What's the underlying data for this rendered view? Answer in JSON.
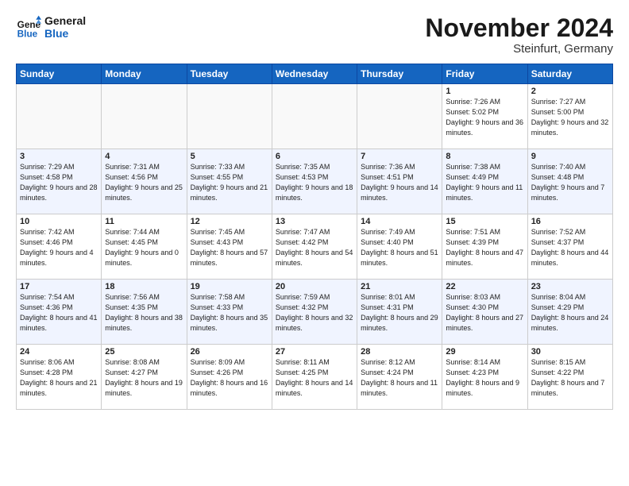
{
  "logo": {
    "line1": "General",
    "line2": "Blue"
  },
  "title": "November 2024",
  "subtitle": "Steinfurt, Germany",
  "days_of_week": [
    "Sunday",
    "Monday",
    "Tuesday",
    "Wednesday",
    "Thursday",
    "Friday",
    "Saturday"
  ],
  "weeks": [
    [
      {
        "day": "",
        "info": ""
      },
      {
        "day": "",
        "info": ""
      },
      {
        "day": "",
        "info": ""
      },
      {
        "day": "",
        "info": ""
      },
      {
        "day": "",
        "info": ""
      },
      {
        "day": "1",
        "info": "Sunrise: 7:26 AM\nSunset: 5:02 PM\nDaylight: 9 hours and 36 minutes."
      },
      {
        "day": "2",
        "info": "Sunrise: 7:27 AM\nSunset: 5:00 PM\nDaylight: 9 hours and 32 minutes."
      }
    ],
    [
      {
        "day": "3",
        "info": "Sunrise: 7:29 AM\nSunset: 4:58 PM\nDaylight: 9 hours and 28 minutes."
      },
      {
        "day": "4",
        "info": "Sunrise: 7:31 AM\nSunset: 4:56 PM\nDaylight: 9 hours and 25 minutes."
      },
      {
        "day": "5",
        "info": "Sunrise: 7:33 AM\nSunset: 4:55 PM\nDaylight: 9 hours and 21 minutes."
      },
      {
        "day": "6",
        "info": "Sunrise: 7:35 AM\nSunset: 4:53 PM\nDaylight: 9 hours and 18 minutes."
      },
      {
        "day": "7",
        "info": "Sunrise: 7:36 AM\nSunset: 4:51 PM\nDaylight: 9 hours and 14 minutes."
      },
      {
        "day": "8",
        "info": "Sunrise: 7:38 AM\nSunset: 4:49 PM\nDaylight: 9 hours and 11 minutes."
      },
      {
        "day": "9",
        "info": "Sunrise: 7:40 AM\nSunset: 4:48 PM\nDaylight: 9 hours and 7 minutes."
      }
    ],
    [
      {
        "day": "10",
        "info": "Sunrise: 7:42 AM\nSunset: 4:46 PM\nDaylight: 9 hours and 4 minutes."
      },
      {
        "day": "11",
        "info": "Sunrise: 7:44 AM\nSunset: 4:45 PM\nDaylight: 9 hours and 0 minutes."
      },
      {
        "day": "12",
        "info": "Sunrise: 7:45 AM\nSunset: 4:43 PM\nDaylight: 8 hours and 57 minutes."
      },
      {
        "day": "13",
        "info": "Sunrise: 7:47 AM\nSunset: 4:42 PM\nDaylight: 8 hours and 54 minutes."
      },
      {
        "day": "14",
        "info": "Sunrise: 7:49 AM\nSunset: 4:40 PM\nDaylight: 8 hours and 51 minutes."
      },
      {
        "day": "15",
        "info": "Sunrise: 7:51 AM\nSunset: 4:39 PM\nDaylight: 8 hours and 47 minutes."
      },
      {
        "day": "16",
        "info": "Sunrise: 7:52 AM\nSunset: 4:37 PM\nDaylight: 8 hours and 44 minutes."
      }
    ],
    [
      {
        "day": "17",
        "info": "Sunrise: 7:54 AM\nSunset: 4:36 PM\nDaylight: 8 hours and 41 minutes."
      },
      {
        "day": "18",
        "info": "Sunrise: 7:56 AM\nSunset: 4:35 PM\nDaylight: 8 hours and 38 minutes."
      },
      {
        "day": "19",
        "info": "Sunrise: 7:58 AM\nSunset: 4:33 PM\nDaylight: 8 hours and 35 minutes."
      },
      {
        "day": "20",
        "info": "Sunrise: 7:59 AM\nSunset: 4:32 PM\nDaylight: 8 hours and 32 minutes."
      },
      {
        "day": "21",
        "info": "Sunrise: 8:01 AM\nSunset: 4:31 PM\nDaylight: 8 hours and 29 minutes."
      },
      {
        "day": "22",
        "info": "Sunrise: 8:03 AM\nSunset: 4:30 PM\nDaylight: 8 hours and 27 minutes."
      },
      {
        "day": "23",
        "info": "Sunrise: 8:04 AM\nSunset: 4:29 PM\nDaylight: 8 hours and 24 minutes."
      }
    ],
    [
      {
        "day": "24",
        "info": "Sunrise: 8:06 AM\nSunset: 4:28 PM\nDaylight: 8 hours and 21 minutes."
      },
      {
        "day": "25",
        "info": "Sunrise: 8:08 AM\nSunset: 4:27 PM\nDaylight: 8 hours and 19 minutes."
      },
      {
        "day": "26",
        "info": "Sunrise: 8:09 AM\nSunset: 4:26 PM\nDaylight: 8 hours and 16 minutes."
      },
      {
        "day": "27",
        "info": "Sunrise: 8:11 AM\nSunset: 4:25 PM\nDaylight: 8 hours and 14 minutes."
      },
      {
        "day": "28",
        "info": "Sunrise: 8:12 AM\nSunset: 4:24 PM\nDaylight: 8 hours and 11 minutes."
      },
      {
        "day": "29",
        "info": "Sunrise: 8:14 AM\nSunset: 4:23 PM\nDaylight: 8 hours and 9 minutes."
      },
      {
        "day": "30",
        "info": "Sunrise: 8:15 AM\nSunset: 4:22 PM\nDaylight: 8 hours and 7 minutes."
      }
    ]
  ]
}
